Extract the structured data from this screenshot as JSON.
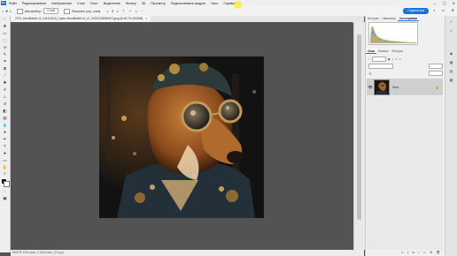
{
  "menubar": {
    "logo": "Ps",
    "items": [
      "Файл",
      "Редактирование",
      "Изображение",
      "Слои",
      "Текст",
      "Выделение",
      "Фильтр",
      "3D",
      "Просмотр",
      "Подключаемые модули",
      "Окно",
      "Справка"
    ]
  },
  "optbar": {
    "tool_label": "Автовыбор:",
    "layer_select": "Слой",
    "transform_label": "Показать упр. элем.",
    "share_label": "Поделиться"
  },
  "document": {
    "tab_title": "2074_MuraBattell v3_1024x2024_Cyano MuraBattell v3_v2_20231028080522.jpeg @ 66,7% (RGB/8)",
    "close_glyph": "×"
  },
  "status": {
    "text": "66,67%  1024 пикс. x 1024 пикс. (72 ppi)"
  },
  "panels": {
    "top_tabs": [
      "История",
      "Навигатор",
      "Гистограмма"
    ],
    "top_active": 2,
    "layers_tabs": [
      "Слои",
      "Каналы",
      "Контуры"
    ],
    "layers_active": 0,
    "layer_name": "Фон"
  },
  "colors": {
    "app_bg": "#535353",
    "accent": "#1473e6",
    "canvas_bg": "#141414"
  }
}
